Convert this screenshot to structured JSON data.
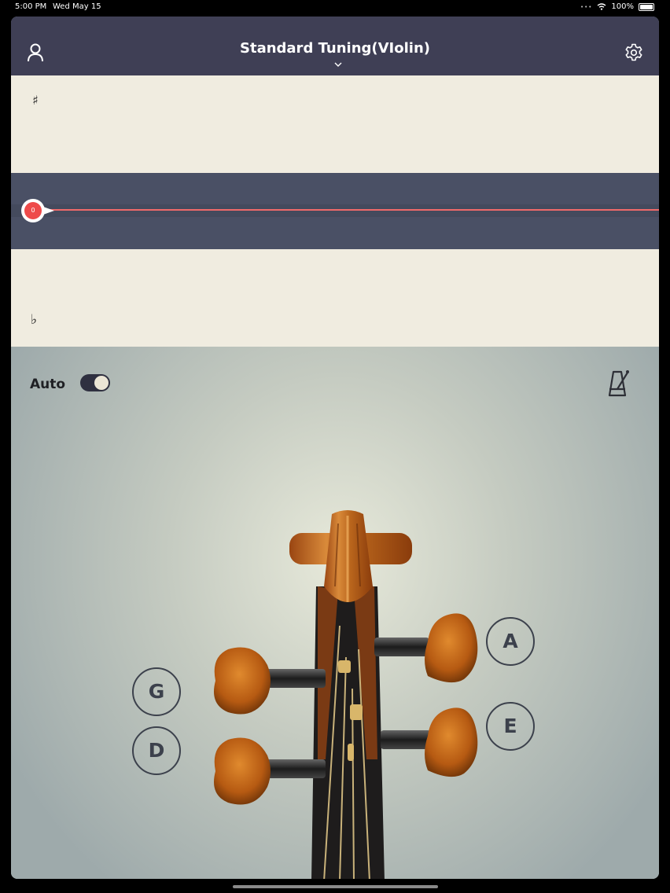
{
  "status_bar": {
    "time": "5:00 PM",
    "date": "Wed May 15",
    "battery": "100%"
  },
  "header": {
    "title": "Standard Tuning(VIolin)",
    "left_icon": "user-icon",
    "right_icon": "gear-icon",
    "dropdown_icon": "chevron-down-icon"
  },
  "tuner": {
    "sharp_symbol": "♯",
    "flat_symbol": "♭",
    "needle_value": "0",
    "accent_color": "#ee4a4a"
  },
  "controls": {
    "auto_label": "Auto",
    "auto_enabled": true,
    "metronome_icon": "metronome-icon"
  },
  "strings": {
    "g": "G",
    "d": "D",
    "a": "A",
    "e": "E"
  },
  "colors": {
    "header_bg": "#3f3f55",
    "staff_bg": "#f0ece0",
    "meter_bg": "#4a5065"
  }
}
